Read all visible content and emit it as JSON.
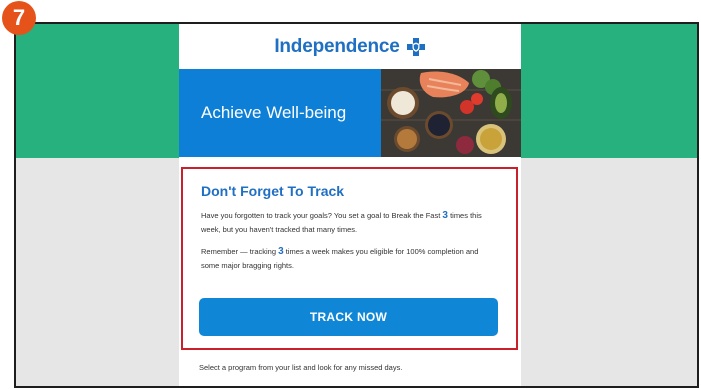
{
  "step_badge": "7",
  "email": {
    "brand_name": "Independence",
    "hero_title": "Achieve Well-being",
    "card": {
      "title": "Don't Forget To Track",
      "paragraph1": {
        "before": "Have you forgotten to track your goals? You set a goal to Break the Fast",
        "number": "3",
        "after": "times this week, but you haven't tracked that many times."
      },
      "paragraph2": {
        "before": "Remember — tracking",
        "number": "3",
        "after": "times a week makes you eligible for 100% completion and some major bragging rights."
      },
      "button_label": "TRACK NOW"
    },
    "footer_text": "Select a program from your list and look for any missed days."
  },
  "colors": {
    "accent_blue": "#0f86d6",
    "band_green": "#26b17f",
    "highlight_red": "#c9202b",
    "badge_orange": "#e5531a"
  },
  "icons": {
    "brand_logo": "blue-cross-shield-icon",
    "hero_image": "healthy-food-photo"
  }
}
